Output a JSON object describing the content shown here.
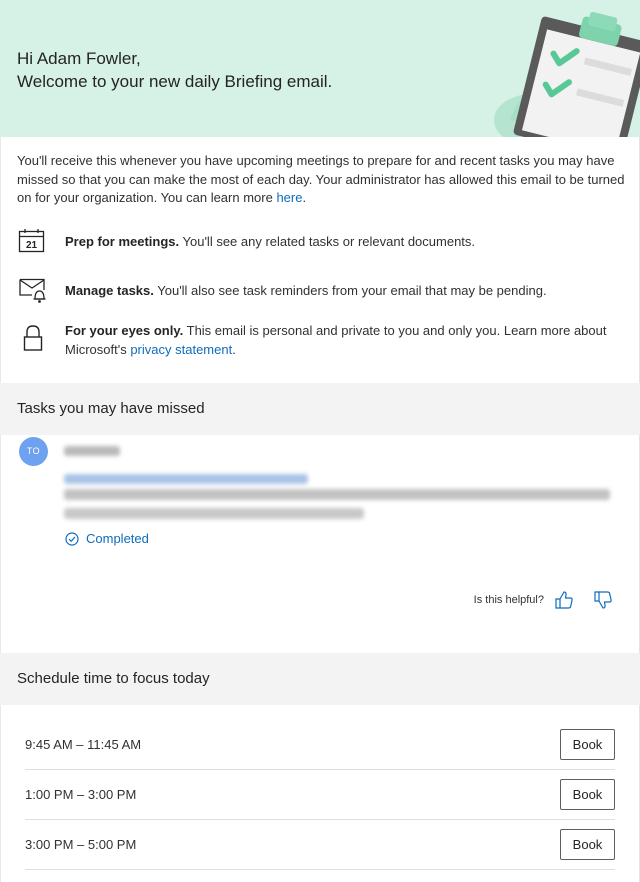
{
  "header": {
    "greeting": "Hi Adam Fowler,",
    "welcome": "Welcome to your new daily Briefing email.",
    "illustration": "clipboard-checklist-illustration"
  },
  "intro": {
    "text": "You'll receive this whenever you have upcoming meetings to prepare for and recent tasks you may have missed so that you can make the most of each day. Your administrator has allowed this email to be turned on for your organization. You can learn more ",
    "link": "here",
    "end": "."
  },
  "features": [
    {
      "icon": "calendar-icon",
      "calendar_day": "21",
      "bold": "Prep for meetings.",
      "text": " You'll see any related tasks or relevant documents."
    },
    {
      "icon": "mail-bell-icon",
      "bold": "Manage tasks.",
      "text": " You'll also see task reminders from your email that may be pending."
    },
    {
      "icon": "lock-icon",
      "bold": "For your eyes only.",
      "text": " This email is personal and private to you and only you. Learn more about Microsoft's ",
      "link": "privacy statement",
      "end": "."
    }
  ],
  "tasks_section": {
    "title": "Tasks you may have missed",
    "task": {
      "avatar_initials": "TO",
      "status": "Completed"
    },
    "helpful": {
      "label": "Is this helpful?",
      "thumbs_up_icon": "thumbs-up-icon",
      "thumbs_down_icon": "thumbs-down-icon"
    }
  },
  "focus_section": {
    "title": "Schedule time to focus today",
    "slots": [
      {
        "time": "9:45 AM – 11:45 AM",
        "button": "Book"
      },
      {
        "time": "1:00 PM – 3:00 PM",
        "button": "Book"
      },
      {
        "time": "3:00 PM – 5:00 PM",
        "button": "Book"
      }
    ]
  },
  "colors": {
    "hero_bg": "#d6f1e6",
    "accent": "#0f6cbd",
    "section_bg": "#f3f3f3",
    "avatar": "#6ea1f0"
  }
}
